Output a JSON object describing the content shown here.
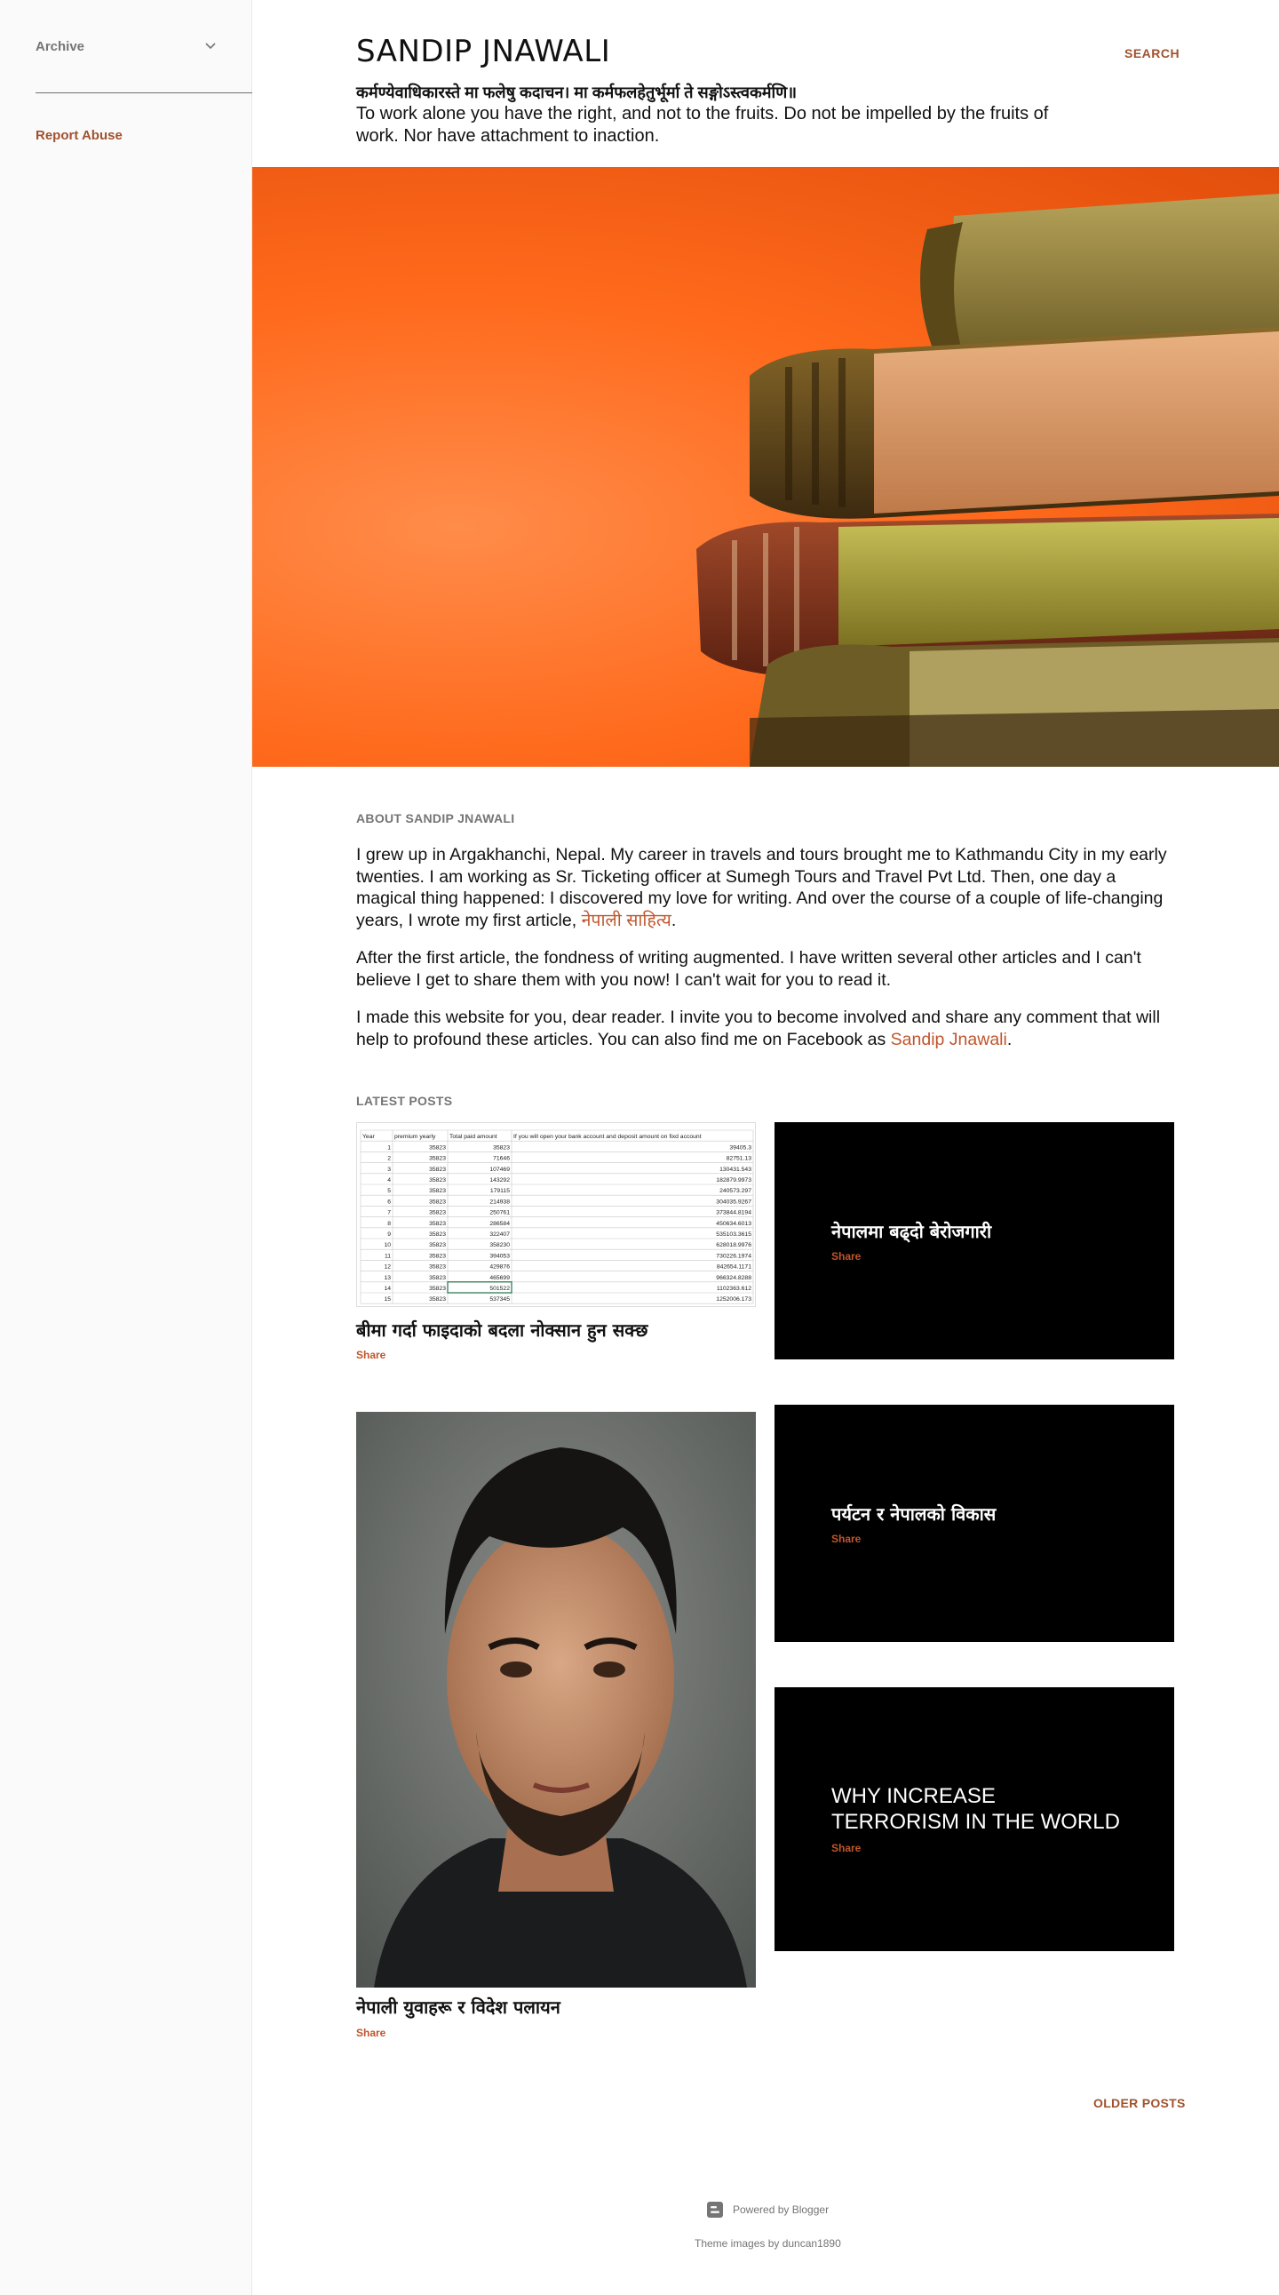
{
  "sidebar": {
    "archive_label": "Archive",
    "report_abuse_label": "Report Abuse"
  },
  "header": {
    "title": "SANDIP JNAWALI",
    "search_label": "SEARCH",
    "description_sanskrit": "कर्मण्येवाधिकारस्ते मा फलेषु कदाचन। मा कर्मफलहेतुर्भूर्मा ते सङ्गोऽस्त्वकर्मणि॥",
    "description_english": "To work alone you have the right, and not to the fruits. Do not be impelled by the fruits of work. Nor have attachment to inaction."
  },
  "about": {
    "heading": "ABOUT SANDIP JNAWALI",
    "p1_text": "I grew up in Argakhanchi, Nepal. My career in travels and tours brought me to Kathmandu City in my early twenties. I am working as Sr. Ticketing officer at Sumegh Tours and Travel Pvt Ltd. Then, one day a magical thing happened: I discovered my love for writing. And over the course of a couple of life-changing years, I wrote my first article, ",
    "p1_link": "नेपाली साहित्य",
    "p1_end": ".",
    "p2": "After the first article, the fondness of writing augmented. I have written several other articles and I can't believe I get to share them with you now! I can't wait for you to read it.",
    "p3_text": "I made this website for you, dear reader. I invite you to become involved and share any comment that will help to profound these articles. You can also find me on Facebook as ",
    "p3_link": "Sandip Jnawali",
    "p3_end": "."
  },
  "latest": {
    "heading": "LATEST POSTS",
    "share_label": "Share",
    "posts": [
      {
        "title": "बीमा गर्दा फाइदाको बदला नोक्सान हुन सक्छ"
      },
      {
        "title": "नेपालमा बढ्दो बेरोजगारी"
      },
      {
        "title": "पर्यटन र नेपालको विकास"
      },
      {
        "title": "WHY INCREASE TERRORISM IN THE WORLD"
      },
      {
        "title": "नेपाली युवाहरू र विदेश पलायन"
      }
    ]
  },
  "table_image": {
    "headers": [
      "Year",
      "premium yearly",
      "Total paid amount",
      "If you will open your bank account and deposit amount on fixd account"
    ],
    "rows": [
      [
        "1",
        "35823",
        "35823",
        "39405.3"
      ],
      [
        "2",
        "35823",
        "71646",
        "82751.13"
      ],
      [
        "3",
        "35823",
        "107469",
        "130431.543"
      ],
      [
        "4",
        "35823",
        "143292",
        "182879.9973"
      ],
      [
        "5",
        "35823",
        "179115",
        "240573.297"
      ],
      [
        "6",
        "35823",
        "214938",
        "304035.9267"
      ],
      [
        "7",
        "35823",
        "250761",
        "373844.8194"
      ],
      [
        "8",
        "35823",
        "286584",
        "450634.6013"
      ],
      [
        "9",
        "35823",
        "322407",
        "535103.3615"
      ],
      [
        "10",
        "35823",
        "358230",
        "628018.9976"
      ],
      [
        "11",
        "35823",
        "394053",
        "730226.1974"
      ],
      [
        "12",
        "35823",
        "429876",
        "842654.1171"
      ],
      [
        "13",
        "35823",
        "465699",
        "966324.8288"
      ],
      [
        "14",
        "35823",
        "501522",
        "1102363.612"
      ],
      [
        "15",
        "35823",
        "537345",
        "1252006.173"
      ]
    ]
  },
  "older_posts_label": "OLDER POSTS",
  "footer": {
    "powered_by": "Powered by Blogger",
    "theme_credit": "Theme images by duncan1890"
  },
  "colors": {
    "accent": "#a0522d",
    "link": "#c0562c",
    "hero_orange": "#ff6a1c"
  }
}
